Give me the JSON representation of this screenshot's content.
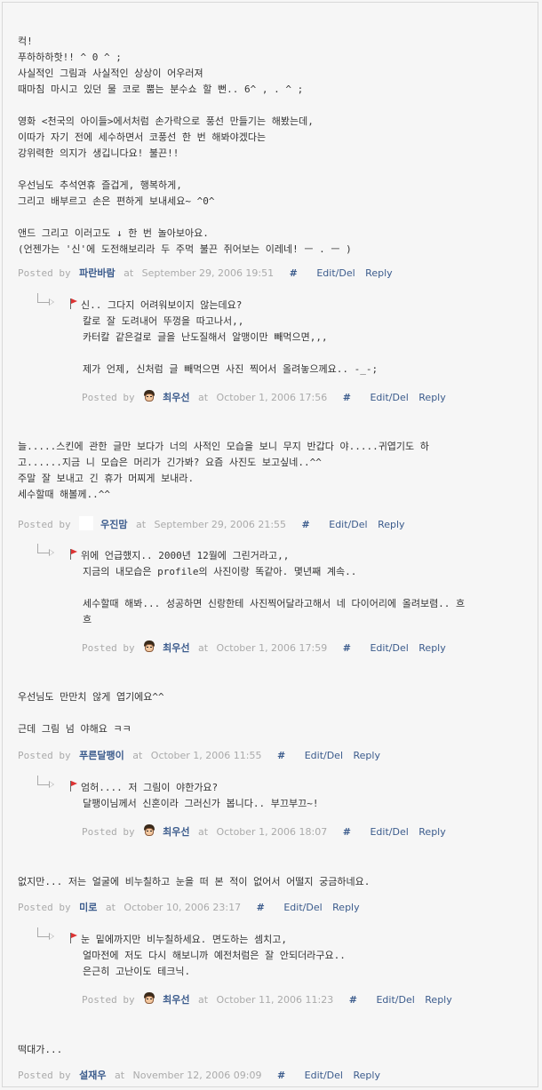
{
  "comments": [
    {
      "lines": [
        "컥!",
        "푸하하하핫!! ^ 0 ^ ;",
        "사실적인 그림과 사실적인 상상이 어우러져",
        "때마침 마시고 있던 물 코로 뿜는 분수쇼 할 뻔.. 6^ , . ^ ;",
        "",
        "영화 <천국의 아이들>에서처럼 손가락으로 풍선 만들기는 해봤는데,",
        "이따가 자기 전에 세수하면서 코풍선 한 번 해봐야겠다는",
        "강위력한 의지가 생깁니다요! 불끈!!",
        "",
        "우선님도 추석연휴 즐겁게, 행복하게,",
        "그리고 배부르고 손은 편하게 보내세요~ ^0^",
        "",
        "앤드 그리고 이러고도 ↓ 한 번 놀아보아요.",
        "(언젠가는 '신'에 도전해보리라 두 주먹 불끈 쥐어보는 이레네! ㅡ . ㅡ )"
      ],
      "posted_by": "Posted by",
      "author": "파란바람",
      "at": "at",
      "date": "September 29, 2006 19:51",
      "hash": "#",
      "editdel": "Edit/Del",
      "reply": "Reply",
      "reply_comment": {
        "lines": [
          "신.. 그다지 어려워보이지 않는데요?",
          "칼로 잘 도려내어 뚜껑을 따고나서,,",
          "카터칼 같은걸로 글을 난도질해서 알맹이만 빼먹으면,,,",
          "",
          "제가 언제, 신처럼 글 빼먹으면 사진 찍어서 올려놓으께요.. -_-;"
        ],
        "posted_by": "Posted by",
        "author": "최우선",
        "at": "at",
        "date": "October 1, 2006 17:56",
        "hash": "#",
        "editdel": "Edit/Del",
        "reply": "Reply"
      }
    },
    {
      "lines": [
        "늘.....스킨에 관한 글만 보다가 너의 사적인 모습을 보니 무지 반갑다 야.....귀엽기도 하",
        "고......지금 니 모습은 머리가 긴가봐? 요즘 사진도 보고싶네..^^",
        "주말 잘 보내고 긴 휴가 머찌게 보내라.",
        "세수할때 해볼께..^^"
      ],
      "posted_by": "Posted by",
      "author": "우진맘",
      "at": "at",
      "date": "September 29, 2006 21:55",
      "hash": "#",
      "editdel": "Edit/Del",
      "reply": "Reply",
      "reply_comment": {
        "lines": [
          "위에 언급했지.. 2000년 12월에 그린거라고,,",
          "지금의 내모습은 profile의 사진이랑 똑같아. 몇년째 계속..",
          "",
          "세수할때 해봐... 성공하면 신랑한테 사진찍어달라고해서 네 다이어리에 올려보렴.. 흐",
          "흐"
        ],
        "posted_by": "Posted by",
        "author": "최우선",
        "at": "at",
        "date": "October 1, 2006 17:59",
        "hash": "#",
        "editdel": "Edit/Del",
        "reply": "Reply"
      }
    },
    {
      "lines": [
        "우선님도 만만치 않게 엽기에요^^",
        "",
        "근데 그림 넘 야해요 ㅋㅋ"
      ],
      "posted_by": "Posted by",
      "author": "푸른달팽이",
      "at": "at",
      "date": "October 1, 2006 11:55",
      "hash": "#",
      "editdel": "Edit/Del",
      "reply": "Reply",
      "reply_comment": {
        "lines": [
          "엄허.... 저 그림이 야한가요?",
          "달팽이님께서 신혼이라 그러신가 봅니다.. 부끄부끄~!"
        ],
        "posted_by": "Posted by",
        "author": "최우선",
        "at": "at",
        "date": "October 1, 2006 18:07",
        "hash": "#",
        "editdel": "Edit/Del",
        "reply": "Reply"
      }
    },
    {
      "lines": [
        "없지만... 저는 얼굴에 비누칠하고 눈을 떠 본 적이 없어서 어떨지 궁금하네요."
      ],
      "posted_by": "Posted by",
      "author": "미로",
      "at": "at",
      "date": "October 10, 2006 23:17",
      "hash": "#",
      "editdel": "Edit/Del",
      "reply": "Reply",
      "reply_comment": {
        "lines": [
          "눈 밑에까지만 비누칠하세요. 면도하는 셈치고,",
          "얼마전에 저도 다시 해보니까 예전처럼은 잘 안되더라구요..",
          "은근히 고난이도 테크닉."
        ],
        "posted_by": "Posted by",
        "author": "최우선",
        "at": "at",
        "date": "October 11, 2006 11:23",
        "hash": "#",
        "editdel": "Edit/Del",
        "reply": "Reply"
      }
    },
    {
      "lines": [
        "떡대가..."
      ],
      "posted_by": "Posted by",
      "author": "설재우",
      "at": "at",
      "date": "November 12, 2006 09:09",
      "hash": "#",
      "editdel": "Edit/Del",
      "reply": "Reply"
    }
  ],
  "colors": {
    "background": "#f6f6f6",
    "text": "#333333",
    "meta": "#aaaaaa",
    "link": "#3b5b8c",
    "flag": "#dd3333"
  }
}
